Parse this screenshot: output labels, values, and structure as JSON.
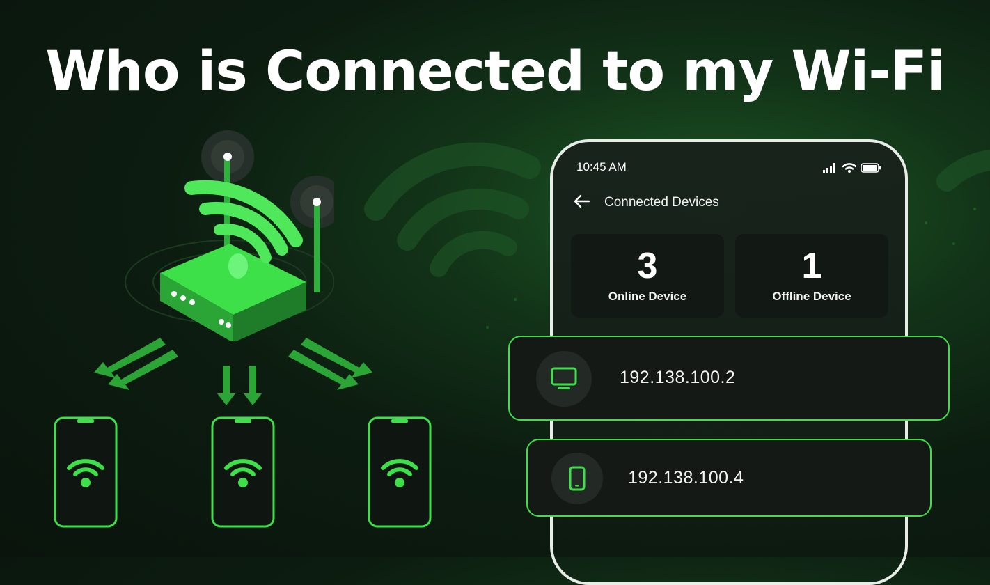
{
  "headline": "Who is Connected to my Wi-Fi",
  "colors": {
    "accent": "#3ee04a",
    "background": "#0c1c10",
    "card": "#121915"
  },
  "phone": {
    "status_time": "10:45 AM",
    "status_icons": [
      "signal-icon",
      "wifi-icon",
      "battery-icon"
    ],
    "screen_title": "Connected Devices",
    "stats": [
      {
        "value": "3",
        "label": "Online Device"
      },
      {
        "value": "1",
        "label": "Offline Device"
      }
    ]
  },
  "devices": [
    {
      "ip": "192.138.100.2",
      "icon": "monitor-icon"
    },
    {
      "ip": "192.138.100.4",
      "icon": "smartphone-icon"
    }
  ],
  "illustration": {
    "router_icon": "router-icon",
    "client_phone_icon": "wifi-phone-icon"
  }
}
